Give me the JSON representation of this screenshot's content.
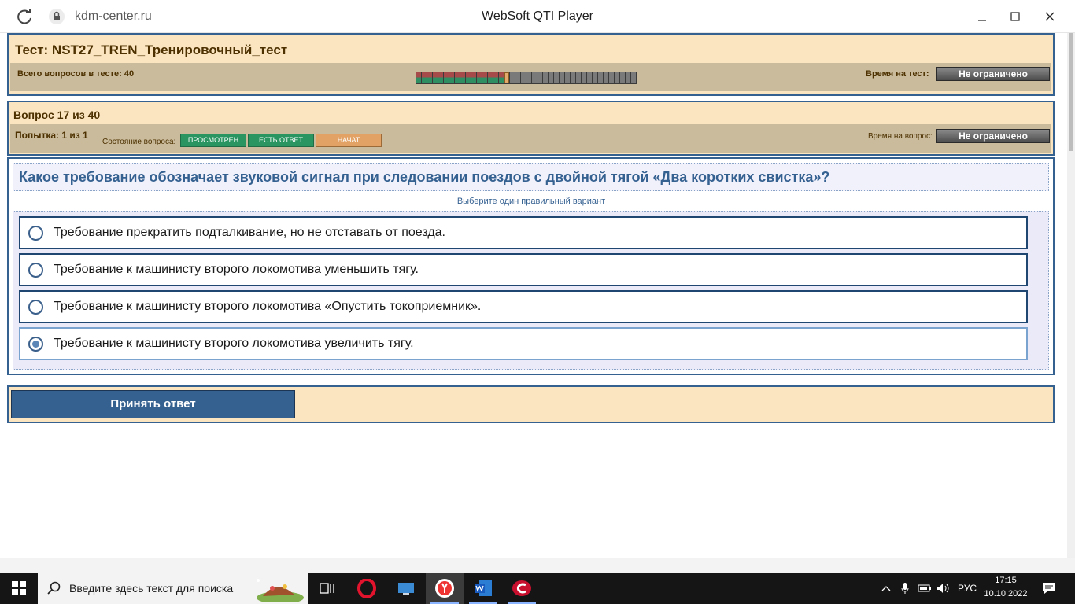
{
  "browser": {
    "url": "kdm-center.ru",
    "window_title": "WebSoft QTI Player"
  },
  "test": {
    "title": "Тест: NST27_TREN_Тренировочный_тест",
    "total_label": "Всего вопросов в тесте: 40",
    "time_label": "Время на тест:",
    "time_value": "Не ограничено",
    "progress": {
      "total": 40,
      "answered": 16,
      "current": 17
    }
  },
  "question_panel": {
    "title": "Вопрос 17 из 40",
    "attempt": "Попытка: 1 из 1",
    "state_label": "Состояние вопроса:",
    "badges": [
      "ПРОСМОТРЕН",
      "ЕСТЬ ОТВЕТ",
      "НАЧАТ"
    ],
    "time_label": "Время на вопрос:",
    "time_value": "Не ограничено"
  },
  "question": {
    "text": "Какое требование обозначает звуковой сигнал при следовании поездов с двойной тягой «Два коротких свистка»?",
    "hint": "Выберите один правильный вариант",
    "options": [
      {
        "label": "Требование прекратить подталкивание, но не отставать от поезда.",
        "selected": false
      },
      {
        "label": "Требование к машинисту второго локомотива уменьшить тягу.",
        "selected": false
      },
      {
        "label": "Требование к машинисту второго локомотива «Опустить токоприемник».",
        "selected": false
      },
      {
        "label": "Требование к машинисту второго локомотива увеличить тягу.",
        "selected": true
      }
    ]
  },
  "submit_label": "Принять ответ",
  "taskbar": {
    "search_placeholder": "Введите здесь текст для поиска",
    "lang": "РУС",
    "time": "17:15",
    "date": "10.10.2022"
  },
  "colors": {
    "panel_bg": "#fbe5c1",
    "panel_border": "#356191",
    "accent_blue": "#356191",
    "badge_green": "#2a9561",
    "badge_orange": "#e2a265"
  }
}
